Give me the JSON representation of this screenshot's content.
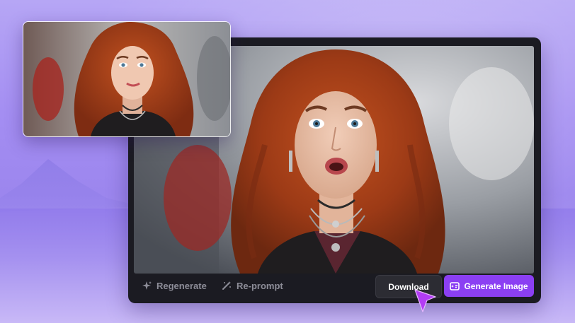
{
  "toolbar": {
    "regenerate_label": "Regenerate",
    "reprompt_label": "Re-prompt",
    "download_label": "Download",
    "generate_label": "Generate Image"
  },
  "icons": {
    "regenerate": "sparkle-icon",
    "reprompt": "magic-wand-icon",
    "generate": "image-generate-icon",
    "cursor": "pointer-cursor-icon"
  },
  "colors": {
    "background": "#a48ef2",
    "panel": "#1b1b22",
    "accent": "#8b3ff3",
    "download_button": "#2c2c33",
    "muted_text": "#8d8d98"
  },
  "images": {
    "main": "generated portrait, surprised expression",
    "thumbnail": "original portrait, smiling"
  }
}
